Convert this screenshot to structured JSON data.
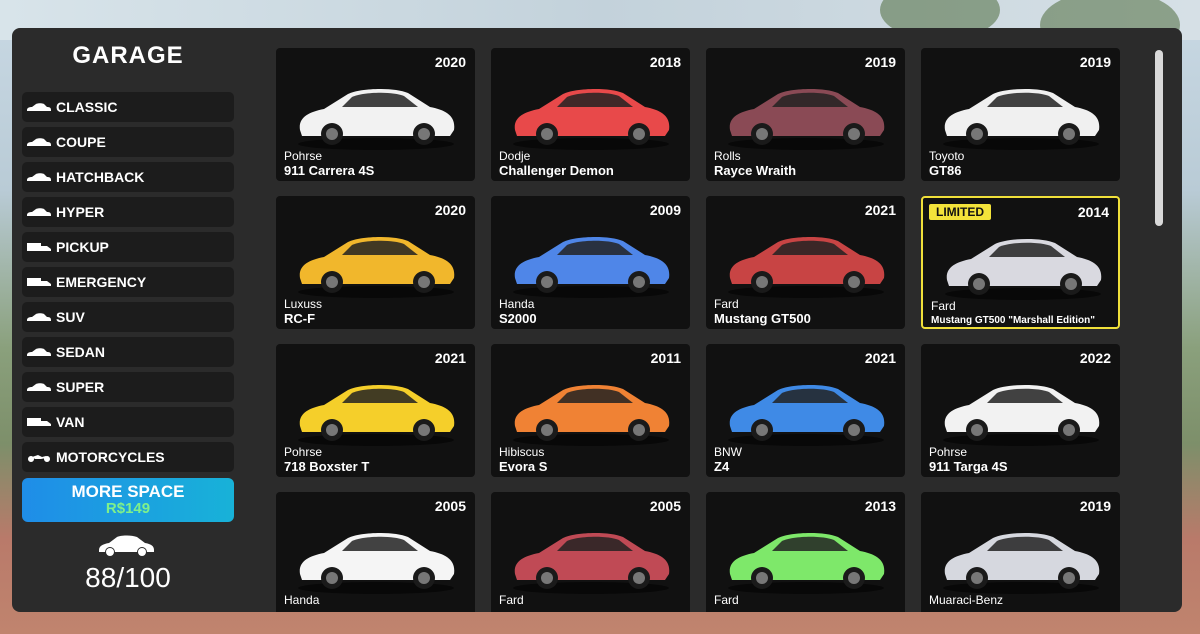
{
  "sidebar": {
    "title": "GARAGE",
    "categories": [
      {
        "label": "CLASSIC",
        "icon": "classic-car-icon"
      },
      {
        "label": "COUPE",
        "icon": "coupe-icon"
      },
      {
        "label": "HATCHBACK",
        "icon": "hatchback-icon"
      },
      {
        "label": "HYPER",
        "icon": "hyper-car-icon"
      },
      {
        "label": "PICKUP",
        "icon": "pickup-truck-icon"
      },
      {
        "label": "EMERGENCY",
        "icon": "emergency-vehicle-icon"
      },
      {
        "label": "SUV",
        "icon": "suv-icon"
      },
      {
        "label": "SEDAN",
        "icon": "sedan-icon"
      },
      {
        "label": "SUPER",
        "icon": "super-car-icon"
      },
      {
        "label": "VAN",
        "icon": "van-icon"
      },
      {
        "label": "MOTORCYCLES",
        "icon": "motorcycle-icon"
      }
    ],
    "more_space": {
      "label": "MORE SPACE",
      "price": "R$149"
    },
    "capacity": "88/100"
  },
  "badge_limited": "LIMITED",
  "cars": [
    {
      "year": "2020",
      "make": "Pohrse",
      "model": "911 Carrera 4S",
      "color": "#f2f2f2"
    },
    {
      "year": "2018",
      "make": "Dodje",
      "model": "Challenger Demon",
      "color": "#e8494a"
    },
    {
      "year": "2019",
      "make": "Rolls",
      "model": "Rayce Wraith",
      "color": "#8a4a55"
    },
    {
      "year": "2019",
      "make": "Toyoto",
      "model": "GT86",
      "color": "#f0f0f0"
    },
    {
      "year": "2020",
      "make": "Luxuss",
      "model": "RC-F",
      "color": "#f1b72c"
    },
    {
      "year": "2009",
      "make": "Handa",
      "model": "S2000",
      "color": "#4f86e8"
    },
    {
      "year": "2021",
      "make": "Fard",
      "model": "Mustang GT500",
      "color": "#c84444"
    },
    {
      "year": "2014",
      "make": "Fard",
      "model": "Mustang GT500 \"Marshall Edition\"",
      "color": "#d9d9e0",
      "limited": true
    },
    {
      "year": "2021",
      "make": "Pohrse",
      "model": "718 Boxster T",
      "color": "#f5cf2a"
    },
    {
      "year": "2011",
      "make": "Hibiscus",
      "model": "Evora S",
      "color": "#f08234"
    },
    {
      "year": "2021",
      "make": "BNW",
      "model": "Z4",
      "color": "#3f8ae6"
    },
    {
      "year": "2022",
      "make": "Pohrse",
      "model": "911 Targa 4S",
      "color": "#f2f2f2"
    },
    {
      "year": "2005",
      "make": "Handa",
      "model": "",
      "color": "#f5f5f5"
    },
    {
      "year": "2005",
      "make": "Fard",
      "model": "",
      "color": "#c04a55"
    },
    {
      "year": "2013",
      "make": "Fard",
      "model": "",
      "color": "#7ee86a"
    },
    {
      "year": "2019",
      "make": "Muaraci-Benz",
      "model": "",
      "color": "#d6d8df"
    }
  ]
}
